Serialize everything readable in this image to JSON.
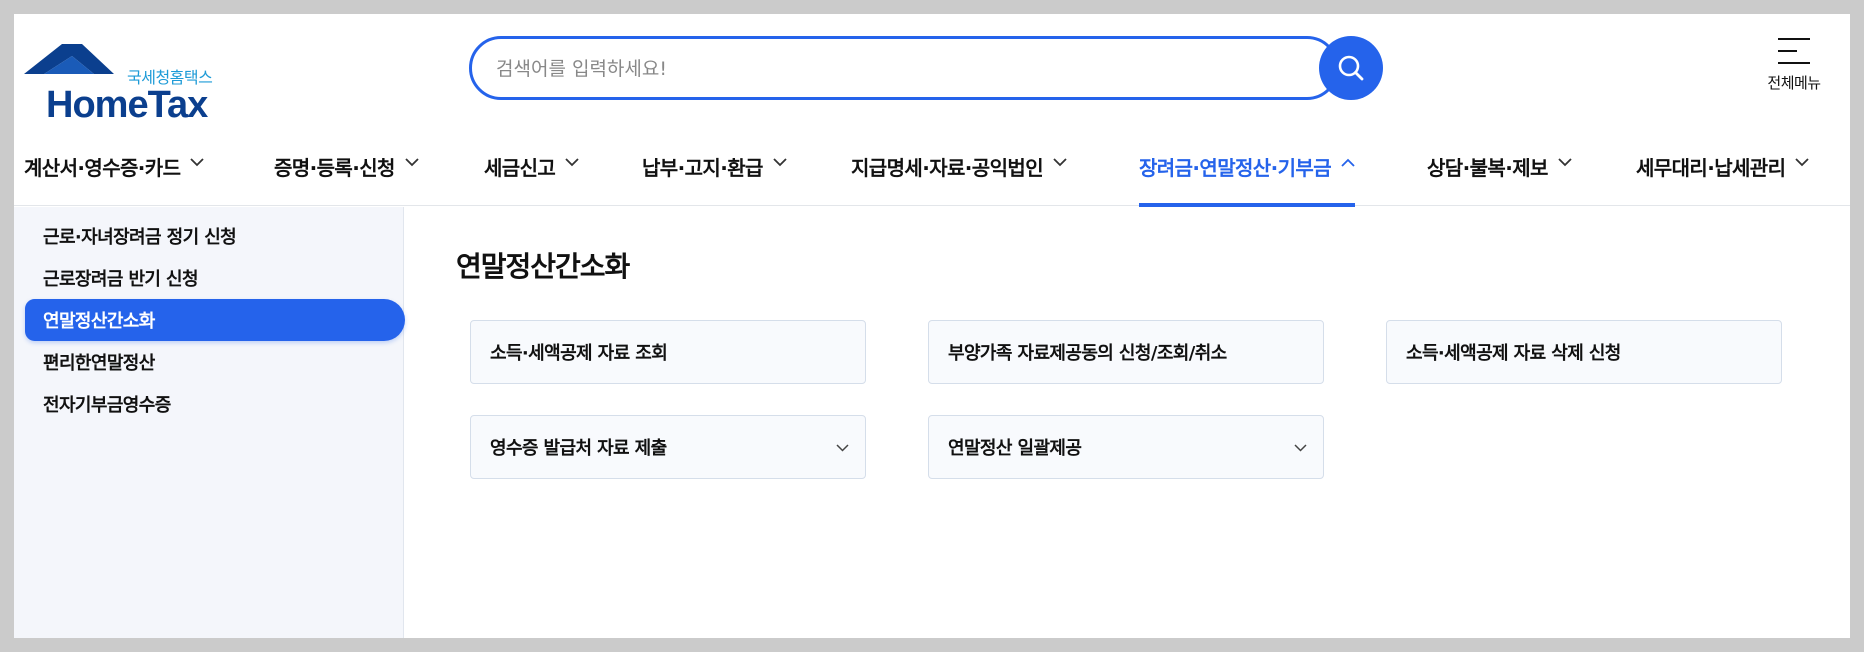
{
  "header": {
    "logo_sub": "국세청홈택스",
    "logo_main": "HomeTax",
    "search_placeholder": "검색어를 입력하세요!",
    "menu_label": "전체메뉴"
  },
  "nav": {
    "items": [
      {
        "label": "계산서·영수증·카드"
      },
      {
        "label": "증명·등록·신청"
      },
      {
        "label": "세금신고"
      },
      {
        "label": "납부·고지·환급"
      },
      {
        "label": "지급명세·자료·공익법인"
      },
      {
        "label": "장려금·연말정산·기부금"
      },
      {
        "label": "상담·불복·제보"
      },
      {
        "label": "세무대리·납세관리"
      }
    ]
  },
  "sidebar": {
    "items": [
      {
        "label": "근로·자녀장려금 정기 신청"
      },
      {
        "label": "근로장려금 반기 신청"
      },
      {
        "label": "연말정산간소화"
      },
      {
        "label": "편리한연말정산"
      },
      {
        "label": "전자기부금영수증"
      }
    ]
  },
  "content": {
    "title": "연말정산간소화",
    "cards": [
      {
        "label": "소득·세액공제 자료 조회"
      },
      {
        "label": "부양가족 자료제공동의 신청/조회/취소"
      },
      {
        "label": "소득·세액공제 자료 삭제 신청"
      },
      {
        "label": "영수증 발급처 자료 제출"
      },
      {
        "label": "연말정산 일괄제공"
      }
    ]
  },
  "colors": {
    "accent": "#2563eb",
    "logo_navy": "#0b3f8e",
    "logo_cyan": "#1e9bd7",
    "sidebar_bg": "#f4f6fb"
  }
}
